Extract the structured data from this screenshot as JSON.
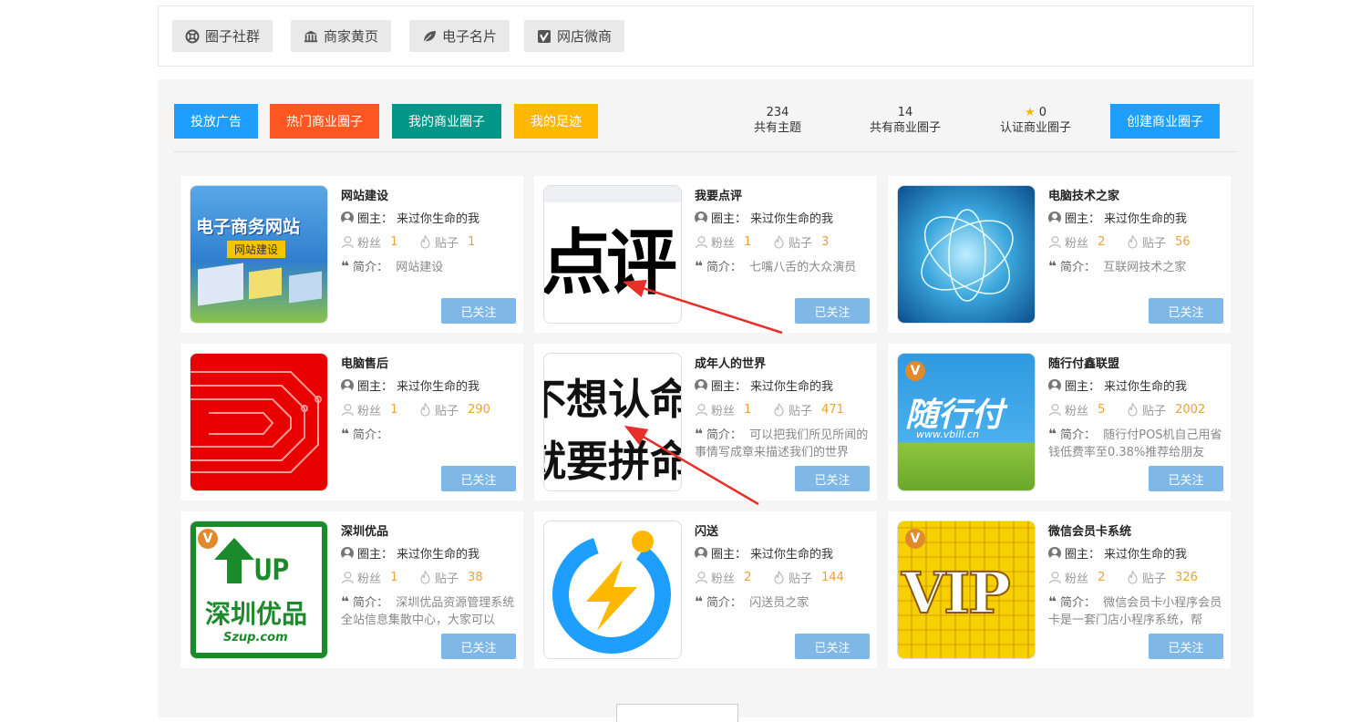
{
  "topnav": [
    {
      "label": "圈子社群",
      "icon": "lifebuoy-icon"
    },
    {
      "label": "商家黄页",
      "icon": "bank-icon"
    },
    {
      "label": "电子名片",
      "icon": "leaf-icon"
    },
    {
      "label": "网店微商",
      "icon": "vimeo-icon"
    }
  ],
  "actions": [
    {
      "label": "投放广告",
      "color": "#1e9fff"
    },
    {
      "label": "热门商业圈子",
      "color": "#ff5722"
    },
    {
      "label": "我的商业圈子",
      "color": "#009688"
    },
    {
      "label": "我的足迹",
      "color": "#ffb800"
    }
  ],
  "stats": [
    {
      "value": "234",
      "label": "共有主题"
    },
    {
      "value": "14",
      "label": "共有商业圈子"
    },
    {
      "value": "0",
      "label": "认证商业圈子"
    }
  ],
  "create_label": "创建商业圈子",
  "labels": {
    "owner": "圈主：",
    "fans": "粉丝",
    "posts": "贴子",
    "intro": "简介：",
    "follow": "已关注"
  },
  "cards": [
    {
      "title": "网站建设",
      "owner": "来过你生命的我",
      "fans": "1",
      "posts": "1",
      "intro": "网站建设",
      "thumb_text": "电子商务网站",
      "thumb_sub": "网站建设"
    },
    {
      "title": "我要点评",
      "owner": "来过你生命的我",
      "fans": "1",
      "posts": "3",
      "intro": "七嘴八舌的大众演员",
      "thumb_text": "点评"
    },
    {
      "title": "电脑技术之家",
      "owner": "来过你生命的我",
      "fans": "2",
      "posts": "56",
      "intro": "互联网技术之家"
    },
    {
      "title": "电脑售后",
      "owner": "来过你生命的我",
      "fans": "1",
      "posts": "290",
      "intro": ""
    },
    {
      "title": "成年人的世界",
      "owner": "来过你生命的我",
      "fans": "1",
      "posts": "471",
      "intro": "可以把我们所见所闻的事情写成章来描述我们的世界",
      "thumb_line1": "不想认命",
      "thumb_line2": "就要拼命"
    },
    {
      "title": "随行付鑫联盟",
      "owner": "来过你生命的我",
      "fans": "5",
      "posts": "2002",
      "intro": "随行付POS机自己用省钱低费率至0.38%推荐给朋友",
      "thumb_text": "随行付",
      "thumb_sub": "www.vbill.cn",
      "badge": "V"
    },
    {
      "title": "深圳优品",
      "owner": "来过你生命的我",
      "fans": "1",
      "posts": "38",
      "intro": "深圳优品资源管理系统全站信息集散中心，大家可以",
      "thumb_text": "UP",
      "thumb_sub": "深圳优品",
      "thumb_sub2": "Szup.com",
      "badge": "V"
    },
    {
      "title": "闪送",
      "owner": "来过你生命的我",
      "fans": "2",
      "posts": "144",
      "intro": "闪送员之家"
    },
    {
      "title": "微信会员卡系统",
      "owner": "来过你生命的我",
      "fans": "2",
      "posts": "326",
      "intro": "微信会员卡小程序会员卡是一套门店小程序系统，帮",
      "thumb_text": "VIP",
      "badge": "V"
    }
  ]
}
